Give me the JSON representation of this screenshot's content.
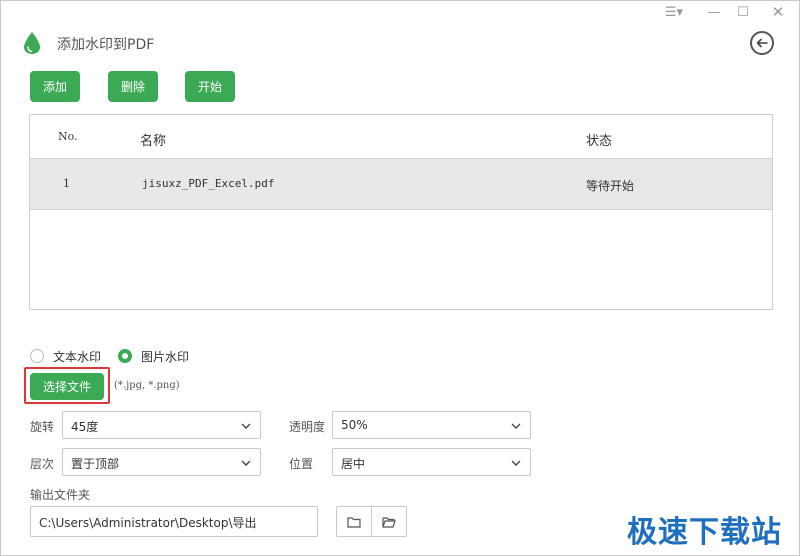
{
  "app": {
    "title": "添加水印到PDF"
  },
  "window_controls": {
    "menu": "☰▾",
    "minimize": "—",
    "maximize": "☐",
    "close": "✕"
  },
  "toolbar": {
    "add_label": "添加",
    "delete_label": "删除",
    "start_label": "开始"
  },
  "table": {
    "headers": {
      "no": "No.",
      "name": "名称",
      "status": "状态"
    },
    "rows": [
      {
        "no": "1",
        "name": "jisuxz_PDF_Excel.pdf",
        "status": "等待开始"
      }
    ]
  },
  "watermark_type": {
    "options": [
      "文本水印",
      "图片水印"
    ],
    "selected": "图片水印"
  },
  "image": {
    "choose_label": "选择文件",
    "extensions_hint": "(*.jpg, *.png)"
  },
  "settings": {
    "rotation": {
      "label": "旋转",
      "value": "45度"
    },
    "opacity": {
      "label": "透明度",
      "value": "50%"
    },
    "layer": {
      "label": "层次",
      "value": "置于顶部"
    },
    "position": {
      "label": "位置",
      "value": "居中"
    }
  },
  "output": {
    "label": "输出文件夹",
    "path": "C:\\Users\\Administrator\\Desktop\\导出"
  },
  "site_watermark": "极速下载站",
  "colors": {
    "accent": "#3caa54",
    "highlight": "#d9393a",
    "row_bg": "#e8e8e8"
  },
  "icons": [
    "droplet-icon",
    "back-arrow-icon",
    "chevron-down-icon",
    "folder-icon",
    "open-folder-icon"
  ]
}
